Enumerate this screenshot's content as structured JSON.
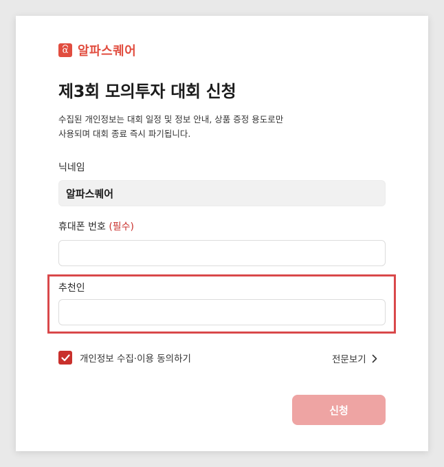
{
  "brand": {
    "logo_glyph": "α",
    "name": "알파스퀘어",
    "color": "#e14d3f"
  },
  "form": {
    "title": "제3회 모의투자 대회 신청",
    "notice_line1": "수집된 개인정보는 대회 일정 및 정보 안내, 상품 증정 용도로만",
    "notice_line2": "사용되며 대회 종료 즉시 파기됩니다.",
    "nickname": {
      "label": "닉네임",
      "value": "알파스퀘어"
    },
    "phone": {
      "label": "휴대폰 번호",
      "required_mark": "(필수)",
      "value": "",
      "placeholder": ""
    },
    "referrer": {
      "label": "추천인",
      "value": "",
      "placeholder": ""
    },
    "consent": {
      "checked": true,
      "label": "개인정보 수집·이용 동의하기",
      "view_full_label": "전문보기"
    },
    "submit_label": "신청"
  },
  "colors": {
    "accent": "#c9302c",
    "submit_disabled": "#eea4a3",
    "highlight_border": "#d9484a"
  },
  "icons": {
    "checkbox": "check-icon",
    "view_full": "chevron-right-icon"
  }
}
